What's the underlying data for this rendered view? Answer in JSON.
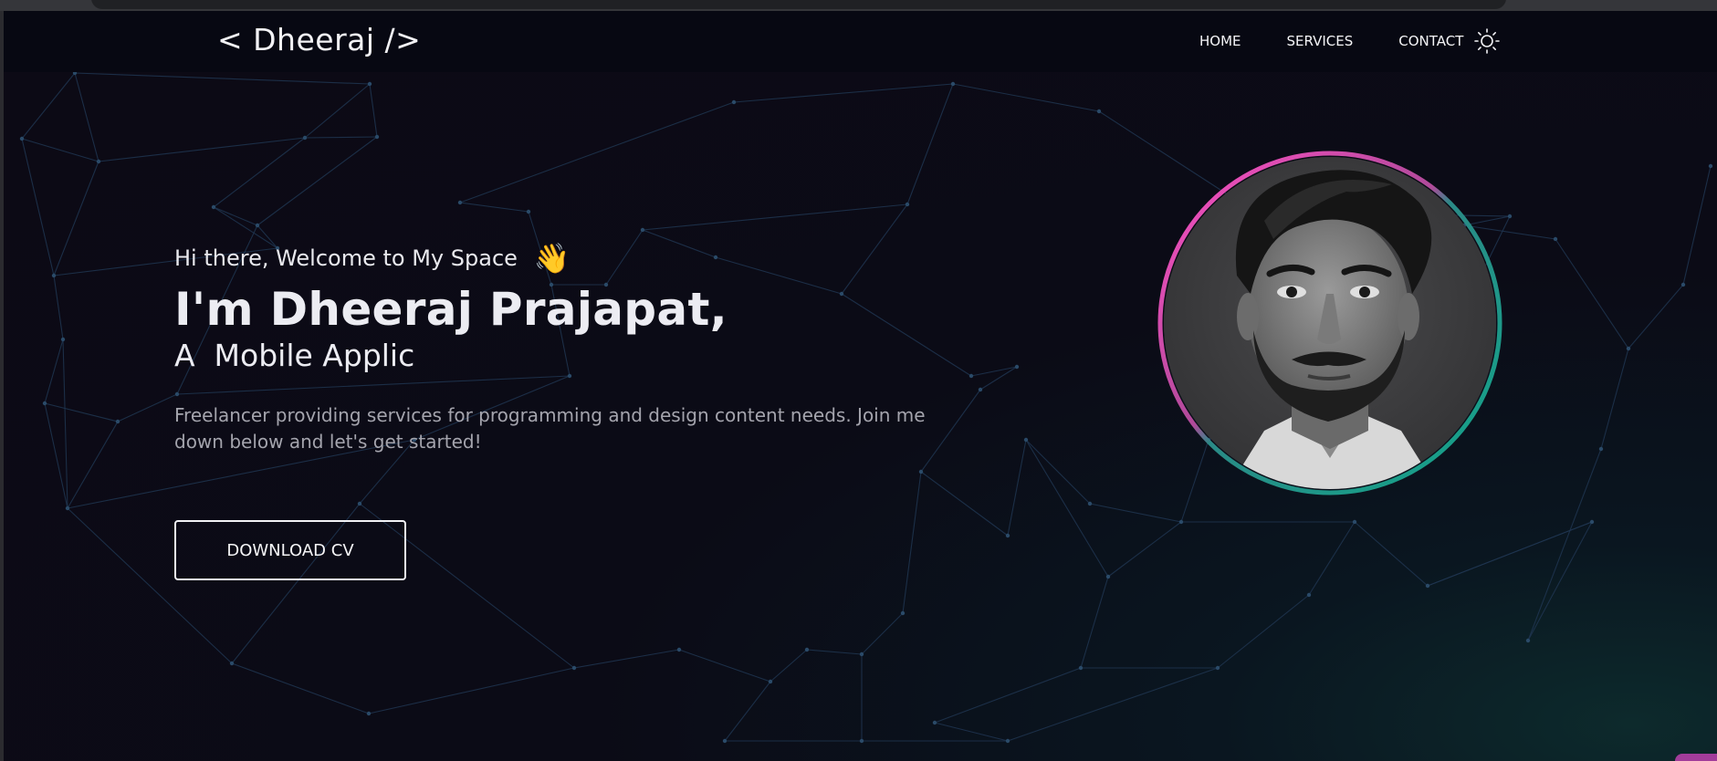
{
  "header": {
    "logo": "< Dheeraj />",
    "nav": [
      {
        "label": "HOME"
      },
      {
        "label": "SERVICES"
      },
      {
        "label": "CONTACT"
      }
    ],
    "theme_icon": "sun-icon"
  },
  "hero": {
    "greeting": "Hi there, Welcome to My Space",
    "wave_emoji": "👋",
    "name": "I'm Dheeraj Prajapat,",
    "role": "A  Mobile Applic",
    "description": "Freelancer providing services for programming and design content needs. Join me down below and let's get started!",
    "cta_label": "DOWNLOAD CV"
  },
  "colors": {
    "background": "#0c0a15",
    "navbar": "#070812",
    "accent_pink": "#ff4fc4",
    "accent_teal": "#1aa88e",
    "text": "#ececf2",
    "muted_text": "#a4a4ad"
  }
}
